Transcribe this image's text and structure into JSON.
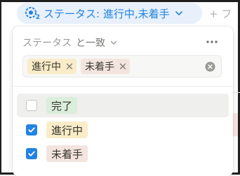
{
  "filter_chip": {
    "label": "ステータス: 進行中,未着手",
    "count": "2",
    "bg": "#e7f0fb",
    "color": "#2383e2"
  },
  "add_filter": {
    "label": "+ フ"
  },
  "popover": {
    "property": "ステータス",
    "condition": "と一致",
    "selected": [
      {
        "label": "進行中",
        "color": "#f9ecc8"
      },
      {
        "label": "未着手",
        "color": "#f3e4de"
      }
    ],
    "options": [
      {
        "label": "完了",
        "checked": false,
        "color": "#dbeddb"
      },
      {
        "label": "進行中",
        "checked": true,
        "color": "#f9ecc8"
      },
      {
        "label": "未着手",
        "checked": true,
        "color": "#f3e4de"
      }
    ],
    "accent": "#2383e2",
    "icons": {
      "more": "more-horizontal-icon",
      "clear": "clear-circle-icon",
      "remove": "x-icon",
      "chevron": "chevron-down-icon"
    }
  }
}
